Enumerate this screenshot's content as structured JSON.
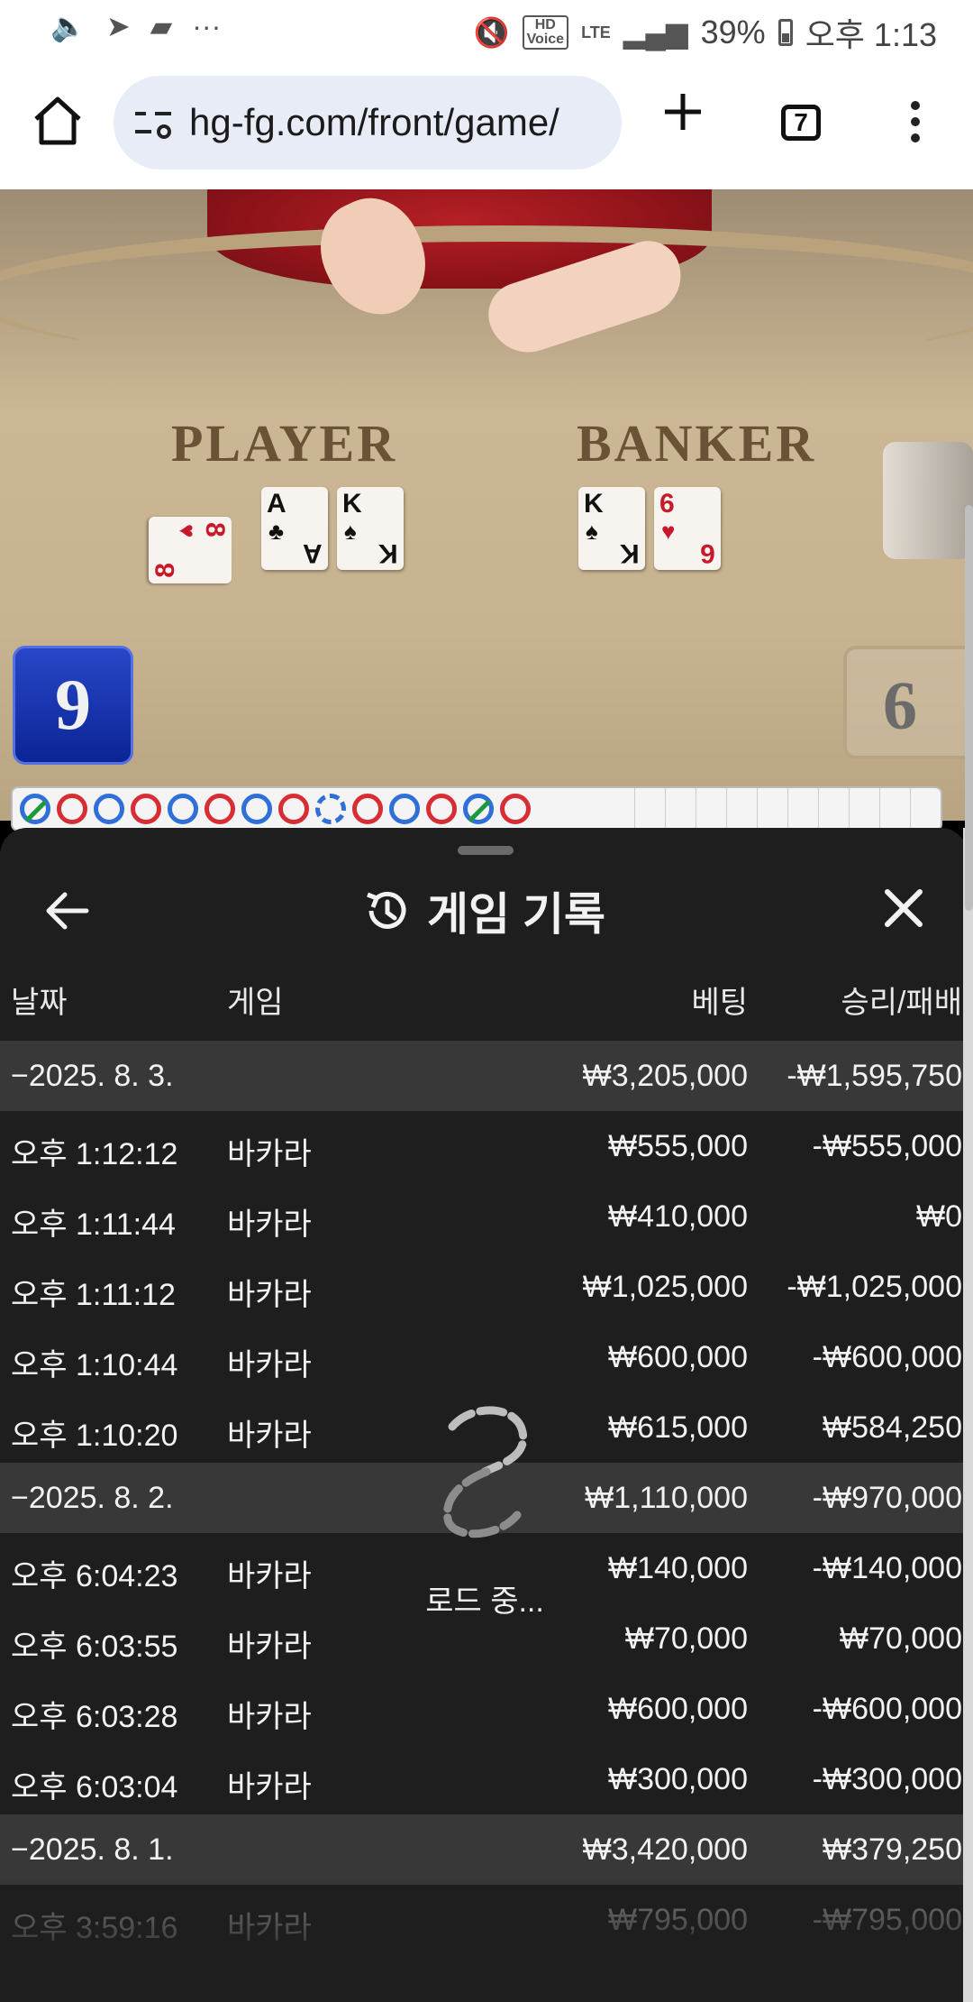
{
  "status_bar": {
    "left_icons": [
      "volume-icon",
      "telegram-icon",
      "chat-icon",
      "more-dots-icon"
    ],
    "hd_voice": "HD\nVoice",
    "lte": "LTE",
    "battery": "39%",
    "time": "오후 1:13"
  },
  "browser": {
    "url": "hg-fg.com/front/game/",
    "tab_count": "7"
  },
  "game": {
    "player_label": "PLAYER",
    "banker_label": "BANKER",
    "player_cards": [
      {
        "rank": "8",
        "suit": "♥",
        "color": "red"
      },
      {
        "rank": "A",
        "suit": "♣",
        "color": "black"
      },
      {
        "rank": "K",
        "suit": "♠",
        "color": "black"
      }
    ],
    "banker_cards": [
      {
        "rank": "K",
        "suit": "♠",
        "color": "black"
      },
      {
        "rank": "6",
        "suit": "♥",
        "color": "red"
      }
    ],
    "player_score": "9",
    "banker_score": "6",
    "road": [
      "B-slash",
      "R",
      "B",
      "R",
      "B",
      "R",
      "B",
      "R",
      "B-dash",
      "R",
      "B",
      "R",
      "B-slash",
      "R"
    ]
  },
  "history": {
    "title": "게임 기록",
    "columns": {
      "date": "날짜",
      "game": "게임",
      "bet": "베팅",
      "result": "승리/패배"
    },
    "rows": [
      {
        "type": "date",
        "date": "−2025. 8. 3.",
        "game": "",
        "bet": "₩3,205,000",
        "result": "-₩1,595,750"
      },
      {
        "type": "item",
        "date": "오후 1:12:12",
        "game": "바카라",
        "bet": "₩555,000",
        "result": "-₩555,000"
      },
      {
        "type": "item",
        "date": "오후 1:11:44",
        "game": "바카라",
        "bet": "₩410,000",
        "result": "₩0"
      },
      {
        "type": "item",
        "date": "오후 1:11:12",
        "game": "바카라",
        "bet": "₩1,025,000",
        "result": "-₩1,025,000"
      },
      {
        "type": "item",
        "date": "오후 1:10:44",
        "game": "바카라",
        "bet": "₩600,000",
        "result": "-₩600,000"
      },
      {
        "type": "item",
        "date": "오후 1:10:20",
        "game": "바카라",
        "bet": "₩615,000",
        "result": "₩584,250"
      },
      {
        "type": "date",
        "date": "−2025. 8. 2.",
        "game": "",
        "bet": "₩1,110,000",
        "result": "-₩970,000"
      },
      {
        "type": "item",
        "date": "오후 6:04:23",
        "game": "바카라",
        "bet": "₩140,000",
        "result": "-₩140,000"
      },
      {
        "type": "item",
        "date": "오후 6:03:55",
        "game": "바카라",
        "bet": "₩70,000",
        "result": "₩70,000"
      },
      {
        "type": "item",
        "date": "오후 6:03:28",
        "game": "바카라",
        "bet": "₩600,000",
        "result": "-₩600,000"
      },
      {
        "type": "item",
        "date": "오후 6:03:04",
        "game": "바카라",
        "bet": "₩300,000",
        "result": "-₩300,000"
      },
      {
        "type": "date",
        "date": "−2025. 8. 1.",
        "game": "",
        "bet": "₩3,420,000",
        "result": "₩379,250"
      },
      {
        "type": "partial",
        "date": "오후 3:59:16",
        "game": "바카라",
        "bet": "₩795,000",
        "result": "-₩795,000"
      }
    ],
    "loading_text": "로드 중..."
  }
}
